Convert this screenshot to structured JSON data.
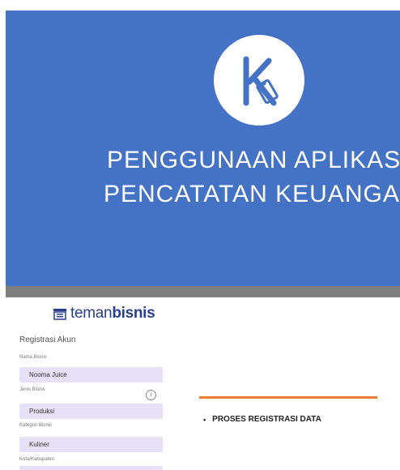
{
  "slide1": {
    "title_line1": "PENGGUNAAN APLIKASI",
    "title_line2": "PENCATATAN KEUANGA"
  },
  "app": {
    "brand_prefix": "teman",
    "brand_suffix": "bisnis"
  },
  "form": {
    "title": "Registrasi Akun",
    "fields": [
      {
        "label": "Nama Bisnis",
        "value": "Nooma Juice"
      },
      {
        "label": "Jenis Bisnis",
        "value": "Produksi"
      },
      {
        "label": "Kategori Bisnis",
        "value": "Kuliner"
      },
      {
        "label": "Kota/Kabupaten",
        "value": ""
      }
    ]
  },
  "slide2": {
    "bullet": "•",
    "item": "PROSES REGISTRASI DATA"
  },
  "colors": {
    "slide_bg": "#4472c4",
    "accent_line": "#ed7d31",
    "field_bg": "#e6e1f7",
    "brand": "#2a3f8f"
  }
}
